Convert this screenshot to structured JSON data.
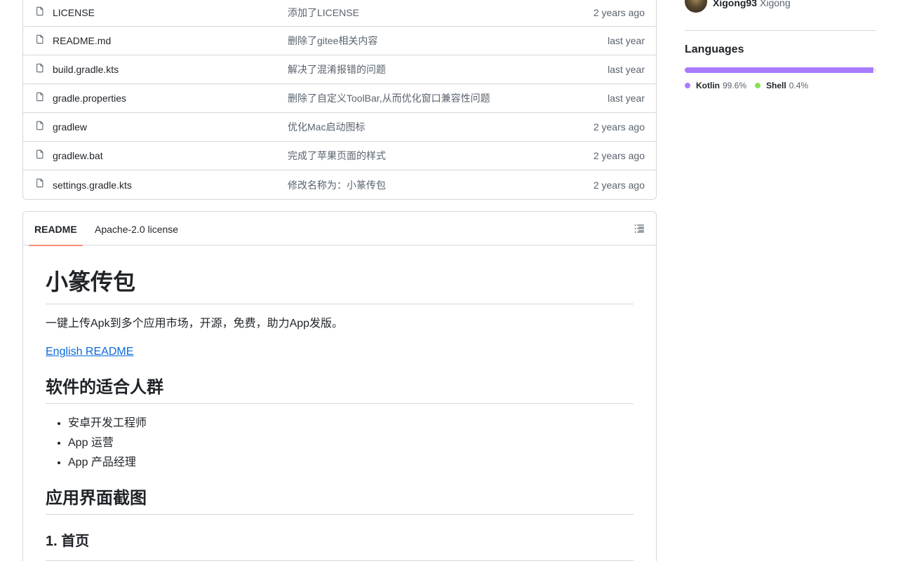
{
  "files": [
    {
      "name": "LICENSE",
      "message": "添加了LICENSE",
      "date": "2 years ago"
    },
    {
      "name": "README.md",
      "message": "删除了gitee相关内容",
      "date": "last year"
    },
    {
      "name": "build.gradle.kts",
      "message": "解决了混淆报错的问题",
      "date": "last year"
    },
    {
      "name": "gradle.properties",
      "message": "删除了自定义ToolBar,从而优化窗口兼容性问题",
      "date": "last year"
    },
    {
      "name": "gradlew",
      "message": "优化Mac启动图标",
      "date": "2 years ago"
    },
    {
      "name": "gradlew.bat",
      "message": "完成了苹果页面的样式",
      "date": "2 years ago"
    },
    {
      "name": "settings.gradle.kts",
      "message": "修改名称为：小篆传包",
      "date": "2 years ago"
    }
  ],
  "readme": {
    "tabs": [
      "README",
      "Apache-2.0 license"
    ],
    "title": "小篆传包",
    "intro": "一键上传Apk到多个应用市场，开源，免费，助力App发版。",
    "link": "English README",
    "section1": "软件的适合人群",
    "audience": [
      "安卓开发工程师",
      "App 运营",
      "App 产品经理"
    ],
    "section2": "应用界面截图",
    "subsection": "1. 首页"
  },
  "sidebar": {
    "contributor_login": "Xigong93",
    "contributor_name": "Xigong",
    "languages_title": "Languages",
    "languages": [
      {
        "name": "Kotlin",
        "percent": "99.6%",
        "value": 99.6,
        "color": "#a97bff"
      },
      {
        "name": "Shell",
        "percent": "0.4%",
        "value": 0.4,
        "color": "#89e051"
      }
    ]
  }
}
